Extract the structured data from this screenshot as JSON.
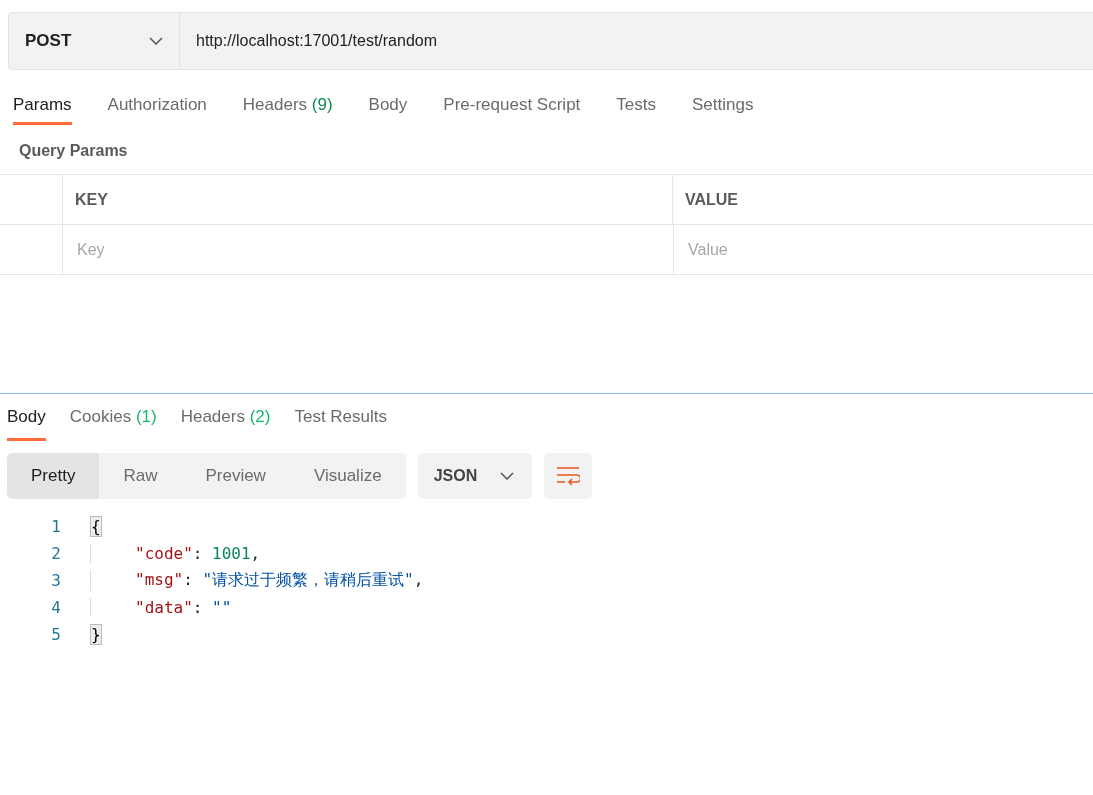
{
  "request": {
    "method": "POST",
    "url": "http://localhost:17001/test/random"
  },
  "request_tabs": [
    {
      "label": "Params",
      "selected": true
    },
    {
      "label": "Authorization",
      "selected": false
    },
    {
      "label": "Headers",
      "count": "(9)",
      "selected": false
    },
    {
      "label": "Body",
      "selected": false
    },
    {
      "label": "Pre-request Script",
      "selected": false
    },
    {
      "label": "Tests",
      "selected": false
    },
    {
      "label": "Settings",
      "selected": false
    }
  ],
  "query_params": {
    "title": "Query Params",
    "columns": [
      "KEY",
      "VALUE"
    ],
    "placeholders": [
      "Key",
      "Value"
    ]
  },
  "response_tabs": [
    {
      "label": "Body",
      "selected": true
    },
    {
      "label": "Cookies",
      "count": "(1)",
      "selected": false
    },
    {
      "label": "Headers",
      "count": "(2)",
      "selected": false
    },
    {
      "label": "Test Results",
      "selected": false
    }
  ],
  "view_modes": [
    {
      "label": "Pretty",
      "selected": true
    },
    {
      "label": "Raw",
      "selected": false
    },
    {
      "label": "Preview",
      "selected": false
    },
    {
      "label": "Visualize",
      "selected": false
    }
  ],
  "format": "JSON",
  "code_lines": [
    {
      "number": "1",
      "tokens": [
        {
          "kind": "match",
          "text": "{"
        }
      ]
    },
    {
      "number": "2",
      "tokens": [
        {
          "kind": "key",
          "text": "\"code\""
        },
        {
          "kind": "punct",
          "text": ": "
        },
        {
          "kind": "number",
          "text": "1001"
        },
        {
          "kind": "punct",
          "text": ","
        }
      ]
    },
    {
      "number": "3",
      "tokens": [
        {
          "kind": "key",
          "text": "\"msg\""
        },
        {
          "kind": "punct",
          "text": ": "
        },
        {
          "kind": "string",
          "text": "\"请求过于频繁，请稍后重试\""
        },
        {
          "kind": "punct",
          "text": ","
        }
      ]
    },
    {
      "number": "4",
      "tokens": [
        {
          "kind": "key",
          "text": "\"data\""
        },
        {
          "kind": "punct",
          "text": ": "
        },
        {
          "kind": "string",
          "text": "\"\""
        }
      ]
    },
    {
      "number": "5",
      "tokens": [
        {
          "kind": "match",
          "text": "}"
        }
      ]
    }
  ]
}
